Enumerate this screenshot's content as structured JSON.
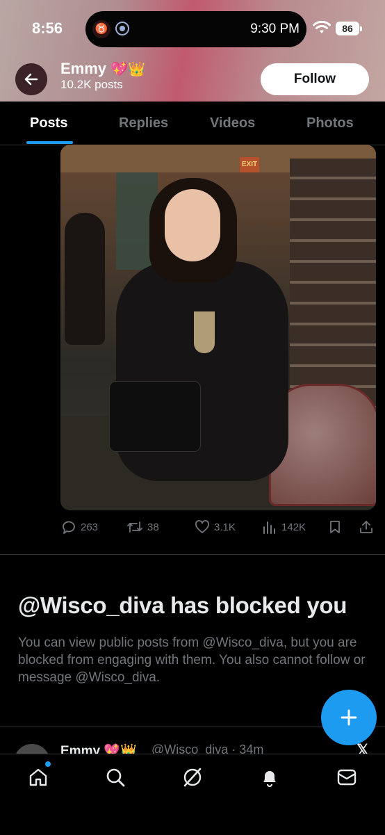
{
  "status_bar": {
    "time": "8:56",
    "island_time": "9:30 PM",
    "battery": "86"
  },
  "header": {
    "name": "Emmy",
    "name_emoji": "💖👑",
    "post_count": "10.2K posts",
    "follow_label": "Follow"
  },
  "tabs": [
    {
      "label": "Posts",
      "active": true
    },
    {
      "label": "Replies"
    },
    {
      "label": "Videos"
    },
    {
      "label": "Photos"
    }
  ],
  "post": {
    "photo_sign": "EXIT",
    "replies": "263",
    "reposts": "38",
    "likes": "3.1K",
    "views": "142K"
  },
  "blocked": {
    "title": "@Wisco_diva has blocked you",
    "body": "You can view public posts from @Wisco_diva, but you are blocked from engaging with them. You also cannot follow or message @Wisco_diva."
  },
  "next_post": {
    "name": "Emmy",
    "name_emoji": "💖👑",
    "handle_time": "@Wisco_diva · 34m"
  },
  "colors": {
    "accent": "#1d9bf0",
    "muted": "#71767b",
    "background": "#000000"
  }
}
